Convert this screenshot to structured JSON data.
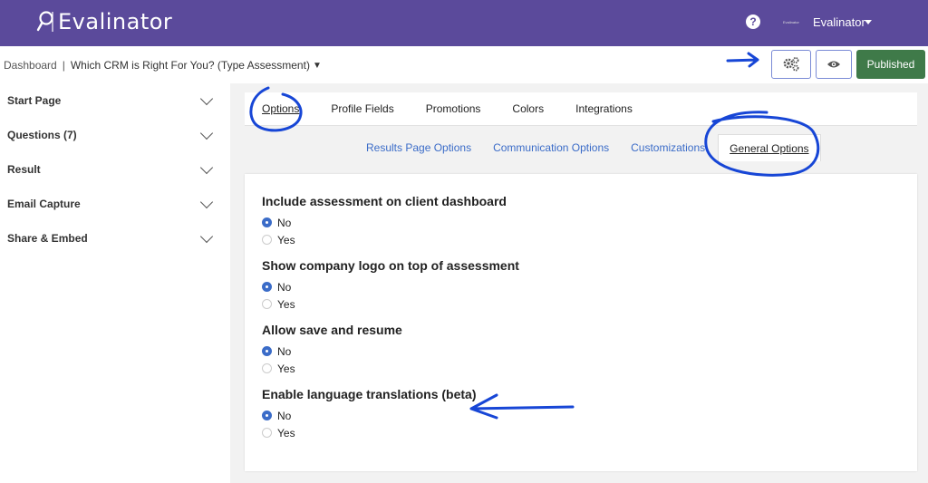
{
  "app": {
    "logo_text": "Evalinator",
    "user_name": "Evalinator",
    "user_avatar_text": "Evalinator"
  },
  "header": {
    "breadcrumb_home": "Dashboard",
    "breadcrumb_separator": "|",
    "breadcrumb_current": "Which CRM is Right For You? (Type Assessment)",
    "published_label": "Published"
  },
  "sidebar": {
    "items": [
      {
        "label": "Start Page"
      },
      {
        "label": "Questions (7)"
      },
      {
        "label": "Result"
      },
      {
        "label": "Email Capture"
      },
      {
        "label": "Share & Embed"
      }
    ]
  },
  "main_tabs": [
    {
      "label": "Options",
      "active": true
    },
    {
      "label": "Profile Fields"
    },
    {
      "label": "Promotions"
    },
    {
      "label": "Colors"
    },
    {
      "label": "Integrations"
    }
  ],
  "sub_tabs": [
    {
      "label": "Results Page Options"
    },
    {
      "label": "Communication Options"
    },
    {
      "label": "Customizations"
    },
    {
      "label": "General Options",
      "active": true
    }
  ],
  "settings": [
    {
      "title": "Include assessment on client dashboard",
      "options": [
        "No",
        "Yes"
      ],
      "selected": "No"
    },
    {
      "title": "Show company logo on top of assessment",
      "options": [
        "No",
        "Yes"
      ],
      "selected": "No"
    },
    {
      "title": "Allow save and resume",
      "options": [
        "No",
        "Yes"
      ],
      "selected": "No"
    },
    {
      "title": "Enable language translations (beta)",
      "options": [
        "No",
        "Yes"
      ],
      "selected": "No"
    }
  ],
  "colors": {
    "brand_purple": "#5b4a9b",
    "published_green": "#3f7a49",
    "link_blue": "#3b6cc8",
    "annotation_blue": "#1746d6"
  },
  "icons": {
    "logo": "magnifier-logo-icon",
    "help": "help-circle-icon",
    "settings": "gears-icon",
    "preview": "eye-icon"
  }
}
